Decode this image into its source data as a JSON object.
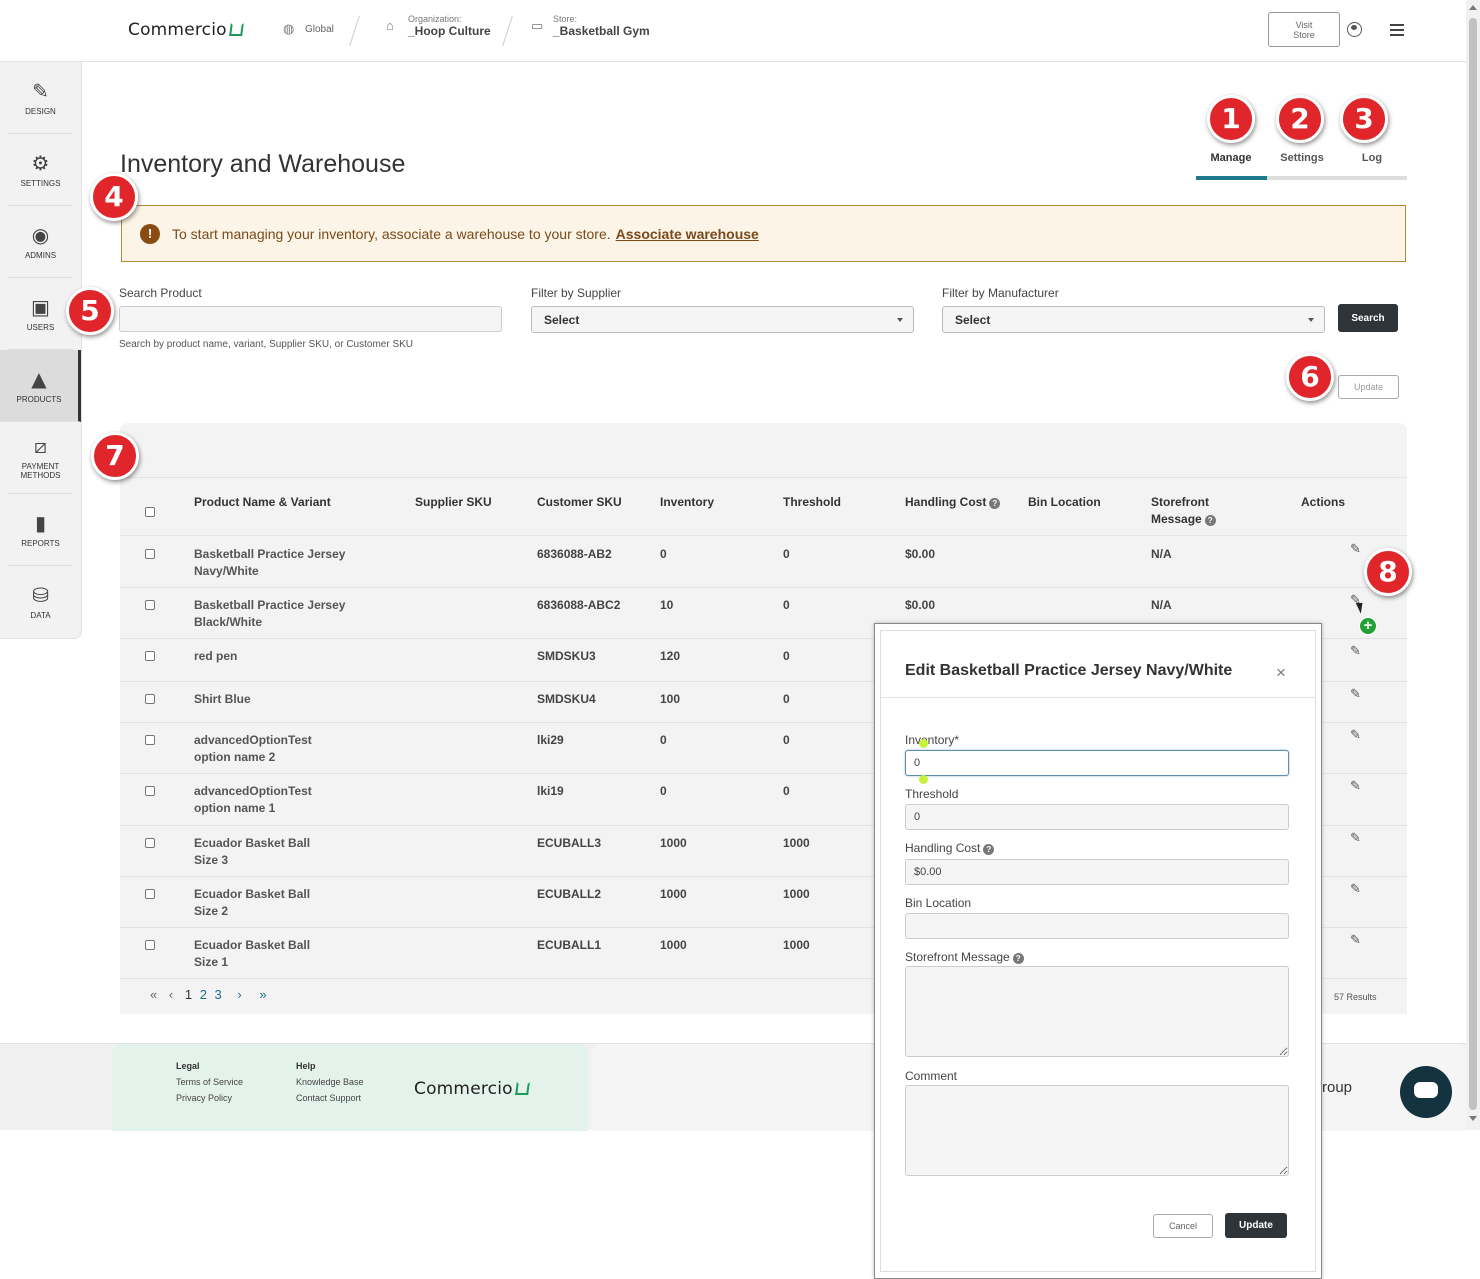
{
  "topbar": {
    "logo": "Commercio",
    "global": "Global",
    "org_label": "Organization:",
    "org_value": "_Hoop Culture",
    "store_label": "Store:",
    "store_value": "_Basketball Gym",
    "visit_store": "Visit Store"
  },
  "sidebar": {
    "items": [
      {
        "label": "DESIGN",
        "icon": "design-icon"
      },
      {
        "label": "SETTINGS",
        "icon": "gear-icon"
      },
      {
        "label": "ADMINS",
        "icon": "admin-icon"
      },
      {
        "label": "USERS",
        "icon": "users-icon"
      },
      {
        "label": "PRODUCTS",
        "icon": "products-icon"
      },
      {
        "label": "PAYMENT METHODS",
        "icon": "payment-icon"
      },
      {
        "label": "REPORTS",
        "icon": "reports-icon"
      },
      {
        "label": "DATA",
        "icon": "database-icon"
      }
    ]
  },
  "page": {
    "title": "Inventory and Warehouse",
    "tabs": [
      "Manage",
      "Settings",
      "Log"
    ]
  },
  "badges": [
    "1",
    "2",
    "3",
    "4",
    "5",
    "6",
    "7",
    "8"
  ],
  "alert": {
    "text": "To start managing your inventory, associate a warehouse to your store.",
    "link": "Associate warehouse"
  },
  "filters": {
    "search_label": "Search Product",
    "search_value": "",
    "search_hint": "Search by product name, variant, Supplier SKU, or Customer SKU",
    "supplier_label": "Filter by Supplier",
    "supplier_value": "Select",
    "manufacturer_label": "Filter by Manufacturer",
    "manufacturer_value": "Select",
    "search_button": "Search",
    "update_button": "Update"
  },
  "table": {
    "headers": [
      "Product Name & Variant",
      "Supplier SKU",
      "Customer SKU",
      "Inventory",
      "Threshold",
      "Handling Cost",
      "Bin Location",
      "Storefront Message",
      "Actions"
    ],
    "rows": [
      {
        "name": "Basketball Practice Jersey",
        "variant": "Navy/White",
        "supplier_sku": "",
        "customer_sku": "6836088-AB2",
        "inventory": "0",
        "threshold": "0",
        "handling": "$0.00",
        "bin": "",
        "message": "N/A"
      },
      {
        "name": "Basketball Practice Jersey",
        "variant": "Black/White",
        "supplier_sku": "",
        "customer_sku": "6836088-ABC2",
        "inventory": "10",
        "threshold": "0",
        "handling": "$0.00",
        "bin": "",
        "message": "N/A"
      },
      {
        "name": "red pen",
        "variant": "",
        "supplier_sku": "",
        "customer_sku": "SMDSKU3",
        "inventory": "120",
        "threshold": "0",
        "handling": "",
        "bin": "",
        "message": ""
      },
      {
        "name": "Shirt Blue",
        "variant": "",
        "supplier_sku": "",
        "customer_sku": "SMDSKU4",
        "inventory": "100",
        "threshold": "0",
        "handling": "",
        "bin": "",
        "message": ""
      },
      {
        "name": "advancedOptionTest",
        "variant": "option name 2",
        "supplier_sku": "",
        "customer_sku": "lki29",
        "inventory": "0",
        "threshold": "0",
        "handling": "",
        "bin": "",
        "message": ""
      },
      {
        "name": "advancedOptionTest",
        "variant": "option name 1",
        "supplier_sku": "",
        "customer_sku": "lki19",
        "inventory": "0",
        "threshold": "0",
        "handling": "",
        "bin": "",
        "message": ""
      },
      {
        "name": "Ecuador Basket Ball",
        "variant": "Size 3",
        "supplier_sku": "",
        "customer_sku": "ECUBALL3",
        "inventory": "1000",
        "threshold": "1000",
        "handling": "",
        "bin": "",
        "message": ""
      },
      {
        "name": "Ecuador Basket Ball",
        "variant": "Size 2",
        "supplier_sku": "",
        "customer_sku": "ECUBALL2",
        "inventory": "1000",
        "threshold": "1000",
        "handling": "",
        "bin": "",
        "message": ""
      },
      {
        "name": "Ecuador Basket Ball",
        "variant": "Size 1",
        "supplier_sku": "",
        "customer_sku": "ECUBALL1",
        "inventory": "1000",
        "threshold": "1000",
        "handling": "",
        "bin": "",
        "message": ""
      }
    ]
  },
  "pagination": {
    "first": "«",
    "prev": "‹",
    "pages": [
      "1",
      "2",
      "3"
    ],
    "next": "›",
    "last": "»",
    "results": "57 Results"
  },
  "footer": {
    "legal": "Legal",
    "terms": "Terms of Service",
    "privacy": "Privacy Policy",
    "help": "Help",
    "kb": "Knowledge Base",
    "support": "Contact Support",
    "logo": "Commercio",
    "group_text": "roup"
  },
  "modal": {
    "title": "Edit Basketball Practice Jersey Navy/White",
    "close": "×",
    "inventory_label": "Inventory*",
    "inventory_value": "0",
    "threshold_label": "Threshold",
    "threshold_value": "0",
    "handling_label": "Handling Cost",
    "handling_value": "$0.00",
    "bin_label": "Bin Location",
    "bin_value": "",
    "storefront_label": "Storefront Message",
    "comment_label": "Comment",
    "cancel": "Cancel",
    "update": "Update"
  },
  "colors": {
    "badge": "#e0262b",
    "tab_active": "#1d7a8c",
    "alert_bg": "#fcf4e6",
    "dark_button": "#2f3439",
    "brand_green": "#1a9b5a"
  }
}
